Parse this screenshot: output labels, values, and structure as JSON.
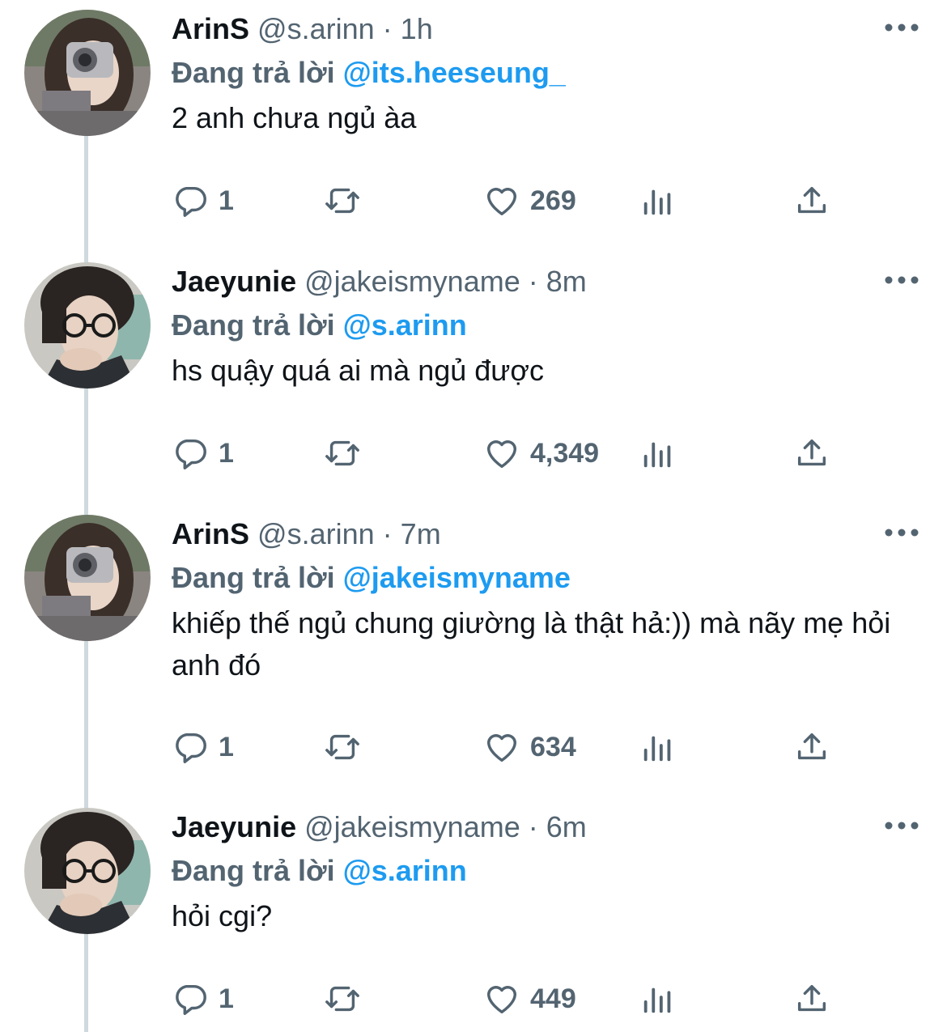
{
  "reply_prefix": "Đang trả lời",
  "colors": {
    "accent": "#1d9bf0",
    "muted": "#536471",
    "text": "#0f1419",
    "thread_line": "#cfd9de"
  },
  "icons": {
    "reply": "reply-icon",
    "retweet": "retweet-icon",
    "like": "heart-icon",
    "views": "analytics-icon",
    "share": "share-icon",
    "more": "more-icon"
  },
  "tweets": [
    {
      "name": "ArinS",
      "handle": "@s.arinn",
      "dot": "·",
      "time": "1h",
      "replying_to": "@its.heeseung_",
      "text": "2 anh chưa ngủ àa",
      "replies": "1",
      "likes": "269"
    },
    {
      "name": "Jaeyunie",
      "handle": "@jakeismyname",
      "dot": "·",
      "time": "8m",
      "replying_to": "@s.arinn",
      "text": "hs quậy quá ai mà ngủ được",
      "replies": "1",
      "likes": "4,349"
    },
    {
      "name": "ArinS",
      "handle": "@s.arinn",
      "dot": "·",
      "time": "7m",
      "replying_to": "@jakeismyname",
      "text": "khiếp thế ngủ chung giường là thật hả:)) mà nãy mẹ hỏi anh đó",
      "replies": "1",
      "likes": "634"
    },
    {
      "name": "Jaeyunie",
      "handle": "@jakeismyname",
      "dot": "·",
      "time": "6m",
      "replying_to": "@s.arinn",
      "text": "hỏi cgi?",
      "replies": "1",
      "likes": "449"
    }
  ]
}
